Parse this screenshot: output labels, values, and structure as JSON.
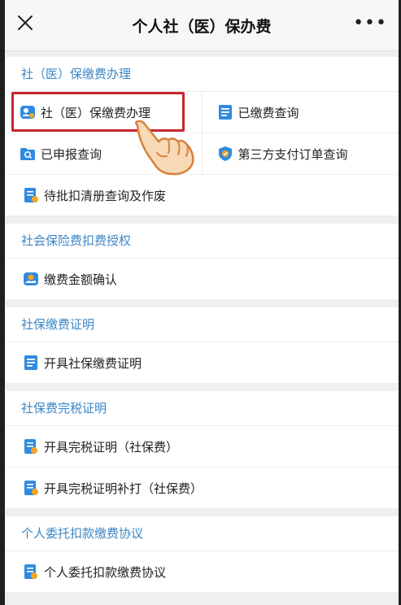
{
  "header": {
    "close_icon": "close-icon",
    "title": "个人社（医）保办费",
    "more_label": "•••"
  },
  "sections": [
    {
      "title": "社（医）保缴费办理",
      "items": [
        {
          "label": "社（医）保缴费办理",
          "icon": "user-badge-icon"
        },
        {
          "label": "已缴费查询",
          "icon": "document-list-icon"
        },
        {
          "label": "已申报查询",
          "icon": "folder-search-icon"
        },
        {
          "label": "第三方支付订单查询",
          "icon": "shield-icon"
        },
        {
          "label": "待批扣清册查询及作废",
          "icon": "document-edit-icon"
        }
      ]
    },
    {
      "title": "社会保险费扣费授权",
      "items": [
        {
          "label": "缴费金额确认",
          "icon": "hand-coin-icon"
        }
      ]
    },
    {
      "title": "社保缴费证明",
      "items": [
        {
          "label": "开具社保缴费证明",
          "icon": "document-list-icon"
        }
      ]
    },
    {
      "title": "社保费完税证明",
      "items": [
        {
          "label": "开具完税证明（社保费）",
          "icon": "document-seal-icon"
        },
        {
          "label": "开具完税证明补打（社保费）",
          "icon": "document-edit-icon"
        }
      ]
    },
    {
      "title": "个人委托扣款缴费协议",
      "items": [
        {
          "label": "个人委托扣款缴费协议",
          "icon": "document-seal-icon"
        }
      ]
    }
  ],
  "colors": {
    "section_title": "#3b86c4",
    "icon_blue": "#2f8be0",
    "icon_orange": "#f5a623",
    "highlight": "#c8262f",
    "background": "#efefef"
  }
}
